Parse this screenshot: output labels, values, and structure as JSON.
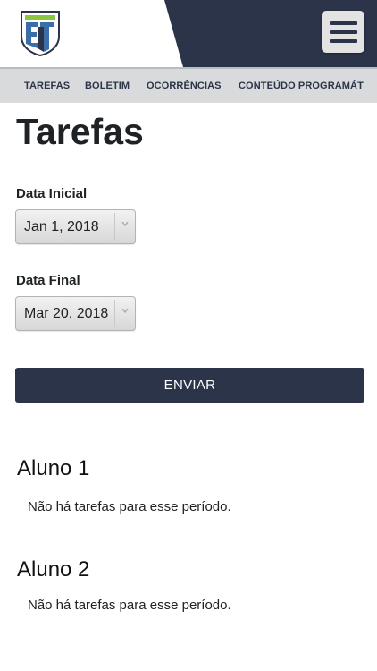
{
  "header": {
    "logo_icon": "school-shield-logo",
    "menu_icon": "hamburger-menu-icon",
    "brand_color": "#2b3448",
    "accent_green": "#8cc63f",
    "accent_blue": "#3b6ea8"
  },
  "nav": {
    "items": [
      {
        "label": "TAREFAS"
      },
      {
        "label": "BOLETIM"
      },
      {
        "label": "OCORRÊNCIAS"
      },
      {
        "label": "CONTEÚDO PROGRAMÁT"
      }
    ]
  },
  "page": {
    "title": "Tarefas",
    "start_label": "Data Inicial",
    "start_value": "Jan 1, 2018",
    "end_label": "Data Final",
    "end_value": "Mar 20, 2018",
    "submit_label": "ENVIAR"
  },
  "students": [
    {
      "name": "Aluno 1",
      "message": "Não há tarefas para esse período."
    },
    {
      "name": "Aluno 2",
      "message": "Não há tarefas para esse período."
    }
  ]
}
